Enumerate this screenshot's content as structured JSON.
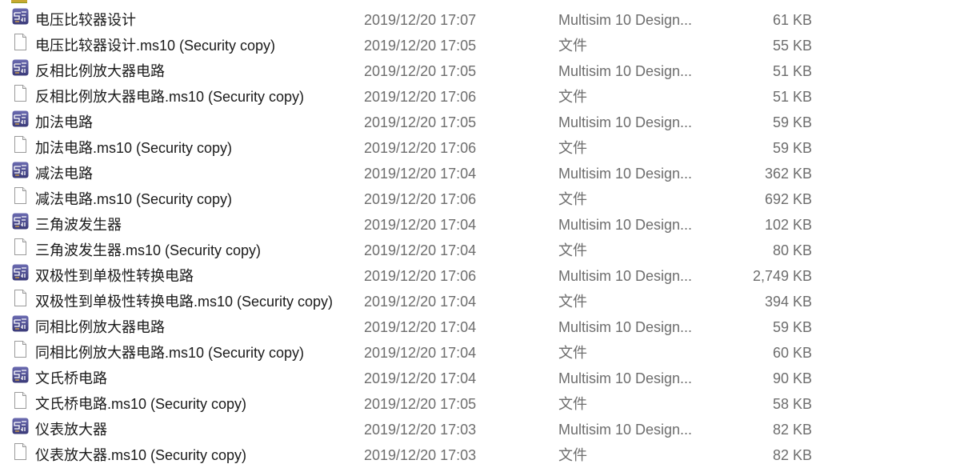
{
  "colors": {
    "multisim_icon": "#4a4a8c",
    "text": "#1a1a1a",
    "meta_text": "#6d6d6d"
  },
  "files": [
    {
      "name": "电压比较器设计",
      "date": "2019/12/20 17:07",
      "type": "Multisim 10 Design...",
      "size": "61 KB",
      "icon": "multisim-icon"
    },
    {
      "name": "电压比较器设计.ms10 (Security copy)",
      "date": "2019/12/20 17:05",
      "type": "文件",
      "size": "55 KB",
      "icon": "file-icon"
    },
    {
      "name": "反相比例放大器电路",
      "date": "2019/12/20 17:05",
      "type": "Multisim 10 Design...",
      "size": "51 KB",
      "icon": "multisim-icon"
    },
    {
      "name": "反相比例放大器电路.ms10 (Security copy)",
      "date": "2019/12/20 17:06",
      "type": "文件",
      "size": "51 KB",
      "icon": "file-icon"
    },
    {
      "name": "加法电路",
      "date": "2019/12/20 17:05",
      "type": "Multisim 10 Design...",
      "size": "59 KB",
      "icon": "multisim-icon"
    },
    {
      "name": "加法电路.ms10 (Security copy)",
      "date": "2019/12/20 17:06",
      "type": "文件",
      "size": "59 KB",
      "icon": "file-icon"
    },
    {
      "name": "减法电路",
      "date": "2019/12/20 17:04",
      "type": "Multisim 10 Design...",
      "size": "362 KB",
      "icon": "multisim-icon"
    },
    {
      "name": "减法电路.ms10 (Security copy)",
      "date": "2019/12/20 17:06",
      "type": "文件",
      "size": "692 KB",
      "icon": "file-icon"
    },
    {
      "name": "三角波发生器",
      "date": "2019/12/20 17:04",
      "type": "Multisim 10 Design...",
      "size": "102 KB",
      "icon": "multisim-icon"
    },
    {
      "name": "三角波发生器.ms10 (Security copy)",
      "date": "2019/12/20 17:04",
      "type": "文件",
      "size": "80 KB",
      "icon": "file-icon"
    },
    {
      "name": "双极性到单极性转换电路",
      "date": "2019/12/20 17:06",
      "type": "Multisim 10 Design...",
      "size": "2,749 KB",
      "icon": "multisim-icon"
    },
    {
      "name": "双极性到单极性转换电路.ms10 (Security copy)",
      "date": "2019/12/20 17:04",
      "type": "文件",
      "size": "394 KB",
      "icon": "file-icon"
    },
    {
      "name": "同相比例放大器电路",
      "date": "2019/12/20 17:04",
      "type": "Multisim 10 Design...",
      "size": "59 KB",
      "icon": "multisim-icon"
    },
    {
      "name": "同相比例放大器电路.ms10 (Security copy)",
      "date": "2019/12/20 17:04",
      "type": "文件",
      "size": "60 KB",
      "icon": "file-icon"
    },
    {
      "name": "文氏桥电路",
      "date": "2019/12/20 17:04",
      "type": "Multisim 10 Design...",
      "size": "90 KB",
      "icon": "multisim-icon"
    },
    {
      "name": "文氏桥电路.ms10 (Security copy)",
      "date": "2019/12/20 17:05",
      "type": "文件",
      "size": "58 KB",
      "icon": "file-icon"
    },
    {
      "name": "仪表放大器",
      "date": "2019/12/20 17:03",
      "type": "Multisim 10 Design...",
      "size": "82 KB",
      "icon": "multisim-icon"
    },
    {
      "name": "仪表放大器.ms10 (Security copy)",
      "date": "2019/12/20 17:03",
      "type": "文件",
      "size": "82 KB",
      "icon": "file-icon"
    }
  ]
}
